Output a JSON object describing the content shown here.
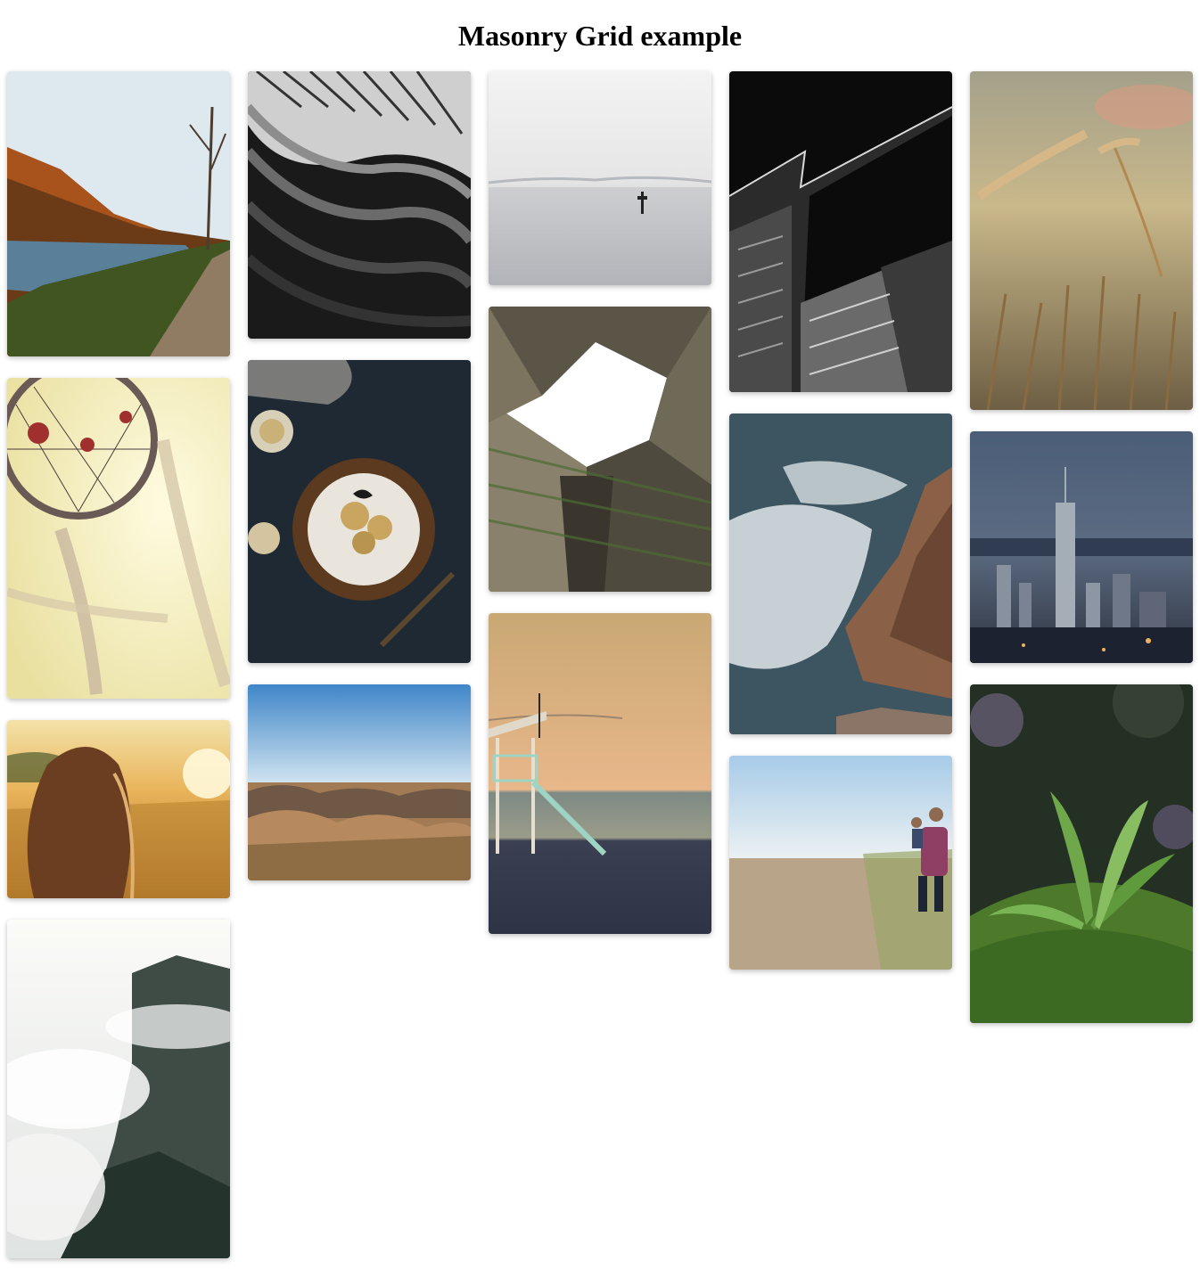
{
  "page": {
    "title": "Masonry Grid example"
  },
  "tiles": [
    {
      "id": "autumn-lake",
      "subject": "autumn lake with path and bare tree"
    },
    {
      "id": "curved-architecture",
      "subject": "black and white curved architecture facade"
    },
    {
      "id": "foggy-sea",
      "subject": "calm grey sea with marker post"
    },
    {
      "id": "dark-skyscraper",
      "subject": "black and white skyscraper looking up"
    },
    {
      "id": "wheat-field",
      "subject": "close-up of wheat stalks"
    },
    {
      "id": "dreamcatcher",
      "subject": "dreamcatcher against bright sky"
    },
    {
      "id": "pear-cake",
      "subject": "pear cake on dark wooden table"
    },
    {
      "id": "courtyard-sky",
      "subject": "looking up through a green courtyard building"
    },
    {
      "id": "ocean-wave-rock",
      "subject": "waves crashing on rocks"
    },
    {
      "id": "night-city",
      "subject": "city skyline at dusk"
    },
    {
      "id": "girl-sunset",
      "subject": "girl in a golden field at sunset"
    },
    {
      "id": "desert-hills",
      "subject": "rolling desert hills under blue sky"
    },
    {
      "id": "lifeguard-tower",
      "subject": "lifeguard tower on beach at sunset"
    },
    {
      "id": "father-child-beach",
      "subject": "man carrying child on beach path"
    },
    {
      "id": "moss-plant",
      "subject": "small plant growing on moss"
    },
    {
      "id": "misty-forest",
      "subject": "misty forest mountain"
    }
  ]
}
